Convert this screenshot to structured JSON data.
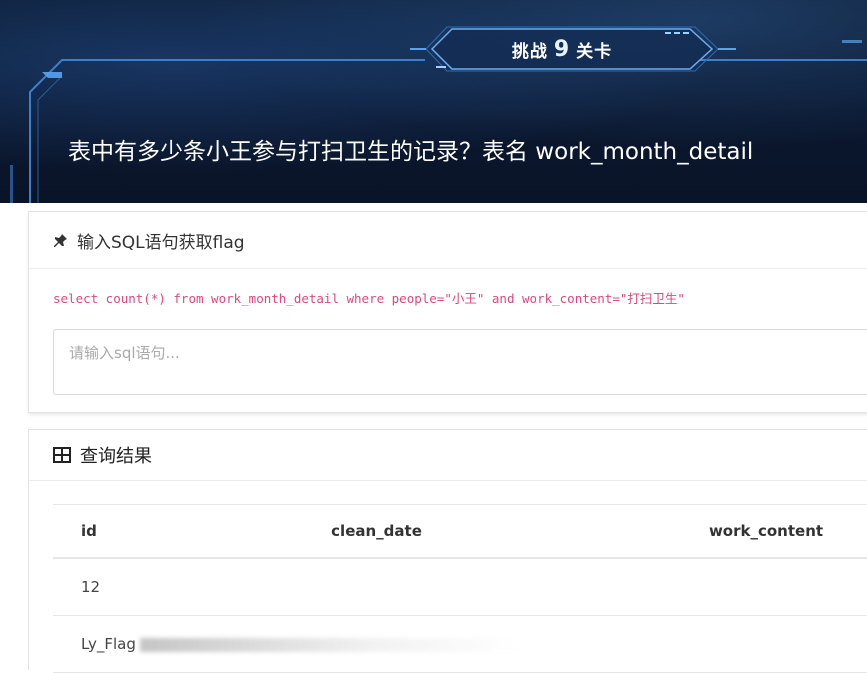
{
  "challenge": {
    "prefix": "挑战",
    "level": "9",
    "suffix": "关卡",
    "question": "表中有多少条小王参与打扫卫生的记录？表名 work_month_detail"
  },
  "sql_panel": {
    "title": "输入SQL语句获取flag",
    "hint": "select count(*) from work_month_detail where people=\"小王\" and work_content=\"打扫卫生\"",
    "input_placeholder": "请输入sql语句...",
    "input_value": ""
  },
  "result_panel": {
    "title": "查询结果",
    "columns": [
      "id",
      "clean_date",
      "work_content"
    ],
    "rows": [
      [
        "12",
        "",
        ""
      ],
      [
        "Ly_Flag",
        "",
        ""
      ]
    ]
  },
  "icons": {
    "sql_panel": "pushpin-icon",
    "result_panel": "table-icon"
  },
  "colors": {
    "banner_bg": "#0b1830",
    "frame_accent": "#4a8fd8",
    "hint_text": "#e0477d"
  }
}
